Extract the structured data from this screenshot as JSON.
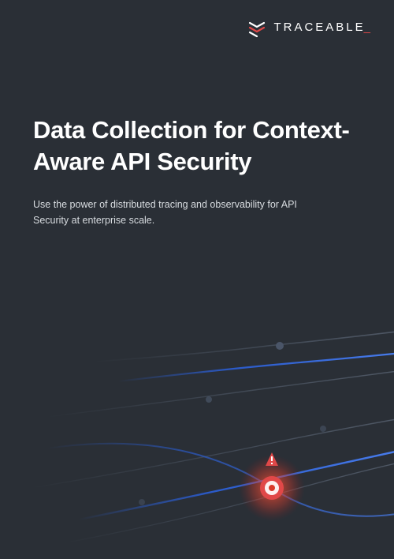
{
  "brand": {
    "name": "TRACEABLE",
    "accent_suffix": "_"
  },
  "document": {
    "title": "Data Collection for Context-Aware API Security",
    "subtitle": "Use the power of distributed tracing and observability for API Security at enterprise scale."
  }
}
